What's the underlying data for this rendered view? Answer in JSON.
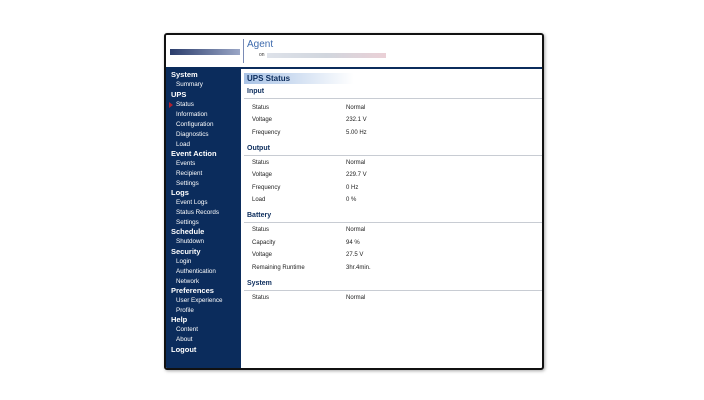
{
  "header": {
    "app_name": "Agent",
    "on_label": "on"
  },
  "sidebar": {
    "active_item": "Status",
    "groups": [
      {
        "label": "System",
        "items": [
          "Summary"
        ]
      },
      {
        "label": "UPS",
        "items": [
          "Status",
          "Information",
          "Configuration",
          "Diagnostics",
          "Load"
        ]
      },
      {
        "label": "Event Action",
        "items": [
          "Events",
          "Recipient",
          "Settings"
        ]
      },
      {
        "label": "Logs",
        "items": [
          "Event Logs",
          "Status Records",
          "Settings"
        ]
      },
      {
        "label": "Schedule",
        "items": [
          "Shutdown"
        ]
      },
      {
        "label": "Security",
        "items": [
          "Login",
          "Authentication",
          "Network"
        ]
      },
      {
        "label": "Preferences",
        "items": [
          "User Experience",
          "Profile"
        ]
      },
      {
        "label": "Help",
        "items": [
          "Content",
          "About"
        ]
      },
      {
        "label": "Logout",
        "items": []
      }
    ]
  },
  "main": {
    "title": "UPS Status",
    "sections": [
      {
        "label": "Input",
        "rows": [
          {
            "label": "Status",
            "value": "Normal"
          },
          {
            "label": "Voltage",
            "value": "232.1 V"
          },
          {
            "label": "Frequency",
            "value": "5.00 Hz"
          }
        ]
      },
      {
        "label": "Output",
        "rows": [
          {
            "label": "Status",
            "value": "Normal"
          },
          {
            "label": "Voltage",
            "value": "229.7 V"
          },
          {
            "label": "Frequency",
            "value": "0 Hz"
          },
          {
            "label": "Load",
            "value": "0 %"
          }
        ]
      },
      {
        "label": "Battery",
        "rows": [
          {
            "label": "Status",
            "value": "Normal"
          },
          {
            "label": "Capacity",
            "value": "94 %"
          },
          {
            "label": "Voltage",
            "value": "27.5 V"
          },
          {
            "label": "Remaining Runtime",
            "value": "3hr.4min."
          }
        ]
      },
      {
        "label": "System",
        "rows": [
          {
            "label": "Status",
            "value": "Normal"
          }
        ]
      }
    ]
  }
}
